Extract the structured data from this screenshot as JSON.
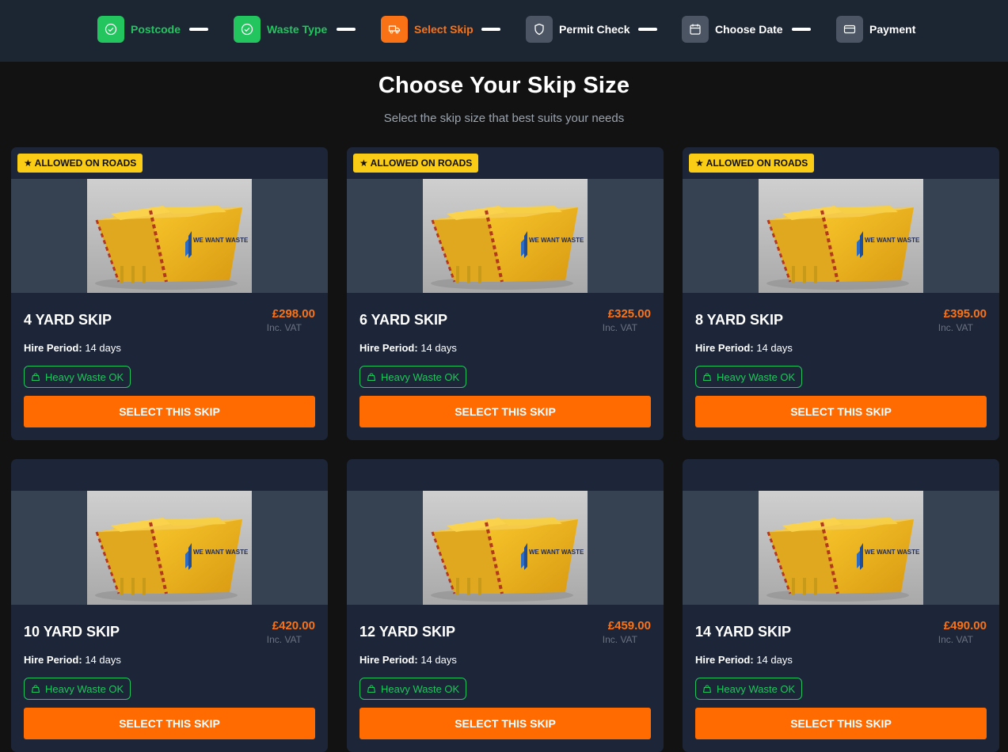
{
  "steps": [
    {
      "label": "Postcode",
      "icon": "check-circle-icon",
      "state": "done"
    },
    {
      "label": "Waste Type",
      "icon": "check-circle-icon",
      "state": "done"
    },
    {
      "label": "Select Skip",
      "icon": "truck-icon",
      "state": "active"
    },
    {
      "label": "Permit Check",
      "icon": "shield-icon",
      "state": "pending"
    },
    {
      "label": "Choose Date",
      "icon": "calendar-icon",
      "state": "pending"
    },
    {
      "label": "Payment",
      "icon": "credit-card-icon",
      "state": "pending"
    }
  ],
  "title": "Choose Your Skip Size",
  "subtitle": "Select the skip size that best suits your needs",
  "labels": {
    "allowed_on_roads": "★ ALLOWED ON ROADS",
    "inc_vat": "Inc. VAT",
    "hire_period_label": "Hire Period:",
    "heavy_waste": "Heavy Waste OK",
    "select_button": "SELECT THIS SKIP",
    "skip_brand": "WE WANT WASTE"
  },
  "skips": [
    {
      "size": "4 YARD SKIP",
      "price": "£298.00",
      "hire_period": "14 days",
      "allowed_on_roads": true
    },
    {
      "size": "6 YARD SKIP",
      "price": "£325.00",
      "hire_period": "14 days",
      "allowed_on_roads": true
    },
    {
      "size": "8 YARD SKIP",
      "price": "£395.00",
      "hire_period": "14 days",
      "allowed_on_roads": true
    },
    {
      "size": "10 YARD SKIP",
      "price": "£420.00",
      "hire_period": "14 days",
      "allowed_on_roads": false
    },
    {
      "size": "12 YARD SKIP",
      "price": "£459.00",
      "hire_period": "14 days",
      "allowed_on_roads": false
    },
    {
      "size": "14 YARD SKIP",
      "price": "£490.00",
      "hire_period": "14 days",
      "allowed_on_roads": false
    }
  ],
  "colors": {
    "done": "#22c55e",
    "active": "#f97316",
    "pending": "#4b5563",
    "button": "#ff6b00",
    "badge": "#facc15",
    "price": "#f97316"
  }
}
